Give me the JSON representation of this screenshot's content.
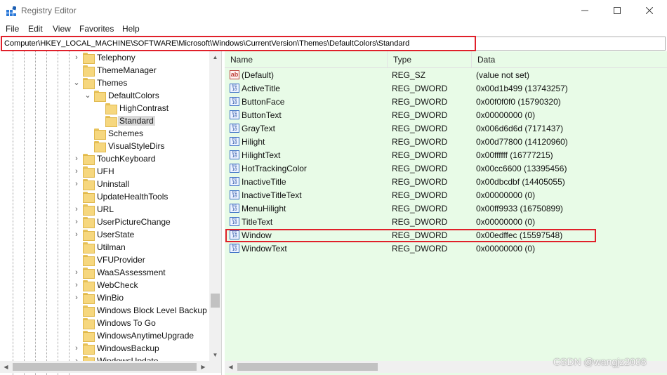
{
  "window": {
    "title": "Registry Editor"
  },
  "menu": [
    "File",
    "Edit",
    "View",
    "Favorites",
    "Help"
  ],
  "address": {
    "path": "Computer\\HKEY_LOCAL_MACHINE\\SOFTWARE\\Microsoft\\Windows\\CurrentVersion\\Themes\\DefaultColors\\Standard"
  },
  "tree": {
    "items": [
      {
        "label": "Telephony",
        "level": 0,
        "expander": "collapsed"
      },
      {
        "label": "ThemeManager",
        "level": 0,
        "expander": "none"
      },
      {
        "label": "Themes",
        "level": 0,
        "expander": "expanded"
      },
      {
        "label": "DefaultColors",
        "level": 1,
        "expander": "expanded"
      },
      {
        "label": "HighContrast",
        "level": 2,
        "expander": "none"
      },
      {
        "label": "Standard",
        "level": 2,
        "expander": "none",
        "selected": true
      },
      {
        "label": "Schemes",
        "level": 1,
        "expander": "none"
      },
      {
        "label": "VisualStyleDirs",
        "level": 1,
        "expander": "none"
      },
      {
        "label": "TouchKeyboard",
        "level": 0,
        "expander": "collapsed"
      },
      {
        "label": "UFH",
        "level": 0,
        "expander": "collapsed"
      },
      {
        "label": "Uninstall",
        "level": 0,
        "expander": "collapsed"
      },
      {
        "label": "UpdateHealthTools",
        "level": 0,
        "expander": "none"
      },
      {
        "label": "URL",
        "level": 0,
        "expander": "collapsed"
      },
      {
        "label": "UserPictureChange",
        "level": 0,
        "expander": "collapsed"
      },
      {
        "label": "UserState",
        "level": 0,
        "expander": "collapsed"
      },
      {
        "label": "Utilman",
        "level": 0,
        "expander": "none"
      },
      {
        "label": "VFUProvider",
        "level": 0,
        "expander": "none"
      },
      {
        "label": "WaaSAssessment",
        "level": 0,
        "expander": "collapsed"
      },
      {
        "label": "WebCheck",
        "level": 0,
        "expander": "collapsed"
      },
      {
        "label": "WinBio",
        "level": 0,
        "expander": "collapsed"
      },
      {
        "label": "Windows Block Level Backup",
        "level": 0,
        "expander": "none"
      },
      {
        "label": "Windows To Go",
        "level": 0,
        "expander": "none"
      },
      {
        "label": "WindowsAnytimeUpgrade",
        "level": 0,
        "expander": "none"
      },
      {
        "label": "WindowsBackup",
        "level": 0,
        "expander": "collapsed"
      },
      {
        "label": "WindowsUpdate",
        "level": 0,
        "expander": "collapsed"
      }
    ]
  },
  "list": {
    "columns": {
      "name": "Name",
      "type": "Type",
      "data": "Data"
    },
    "rows": [
      {
        "name": "(Default)",
        "type": "REG_SZ",
        "data": "(value not set)",
        "icon": "string-value-icon"
      },
      {
        "name": "ActiveTitle",
        "type": "REG_DWORD",
        "data": "0x00d1b499 (13743257)",
        "icon": "binary-value-icon"
      },
      {
        "name": "ButtonFace",
        "type": "REG_DWORD",
        "data": "0x00f0f0f0 (15790320)",
        "icon": "binary-value-icon"
      },
      {
        "name": "ButtonText",
        "type": "REG_DWORD",
        "data": "0x00000000 (0)",
        "icon": "binary-value-icon"
      },
      {
        "name": "GrayText",
        "type": "REG_DWORD",
        "data": "0x006d6d6d (7171437)",
        "icon": "binary-value-icon"
      },
      {
        "name": "Hilight",
        "type": "REG_DWORD",
        "data": "0x00d77800 (14120960)",
        "icon": "binary-value-icon"
      },
      {
        "name": "HilightText",
        "type": "REG_DWORD",
        "data": "0x00ffffff (16777215)",
        "icon": "binary-value-icon"
      },
      {
        "name": "HotTrackingColor",
        "type": "REG_DWORD",
        "data": "0x00cc6600 (13395456)",
        "icon": "binary-value-icon"
      },
      {
        "name": "InactiveTitle",
        "type": "REG_DWORD",
        "data": "0x00dbcdbf (14405055)",
        "icon": "binary-value-icon"
      },
      {
        "name": "InactiveTitleText",
        "type": "REG_DWORD",
        "data": "0x00000000 (0)",
        "icon": "binary-value-icon"
      },
      {
        "name": "MenuHilight",
        "type": "REG_DWORD",
        "data": "0x00ff9933 (16750899)",
        "icon": "binary-value-icon"
      },
      {
        "name": "TitleText",
        "type": "REG_DWORD",
        "data": "0x00000000 (0)",
        "icon": "binary-value-icon"
      },
      {
        "name": "Window",
        "type": "REG_DWORD",
        "data": "0x00edffec (15597548)",
        "icon": "binary-value-icon",
        "highlighted": true
      },
      {
        "name": "WindowText",
        "type": "REG_DWORD",
        "data": "0x00000000 (0)",
        "icon": "binary-value-icon"
      }
    ]
  },
  "watermark": "CSDN @wangjz2008",
  "colors": {
    "list_background": "#e8fbe7",
    "highlight_border": "#e0202a",
    "folder": "#f6d77e"
  }
}
